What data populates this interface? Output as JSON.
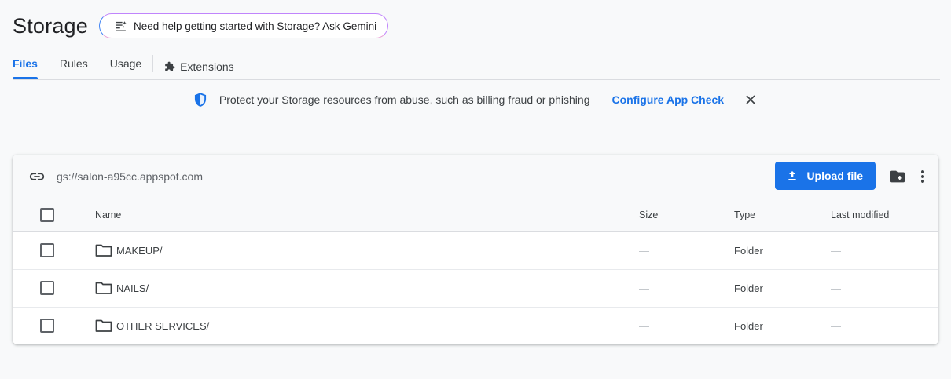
{
  "header": {
    "title": "Storage",
    "gemini_chip_label": "Need help getting started with Storage? Ask Gemini"
  },
  "tabs": [
    {
      "label": "Files",
      "active": true
    },
    {
      "label": "Rules",
      "active": false
    },
    {
      "label": "Usage",
      "active": false
    },
    {
      "label": "Extensions",
      "active": false,
      "icon": "extension-icon"
    }
  ],
  "banner": {
    "icon": "shield-icon",
    "text": "Protect your Storage resources from abuse, such as billing fraud or phishing",
    "link_label": "Configure App Check",
    "close_icon": "close-icon"
  },
  "bucket": {
    "icon": "link-icon",
    "path": "gs://salon-a95cc.appspot.com",
    "upload_label": "Upload file",
    "upload_icon": "upload-icon",
    "add_folder_icon": "create-folder-icon",
    "more_icon": "more-vert-icon"
  },
  "table": {
    "columns": [
      "Name",
      "Size",
      "Type",
      "Last modified"
    ],
    "rows": [
      {
        "name": "MAKEUP/",
        "size": "—",
        "type": "Folder",
        "modified": "—"
      },
      {
        "name": "NAILS/",
        "size": "—",
        "type": "Folder",
        "modified": "—"
      },
      {
        "name": "OTHER SERVICES/",
        "size": "—",
        "type": "Folder",
        "modified": "—"
      }
    ]
  },
  "colors": {
    "accent": "#1a73e8",
    "background": "#f8f9fa",
    "text": "#202124"
  }
}
